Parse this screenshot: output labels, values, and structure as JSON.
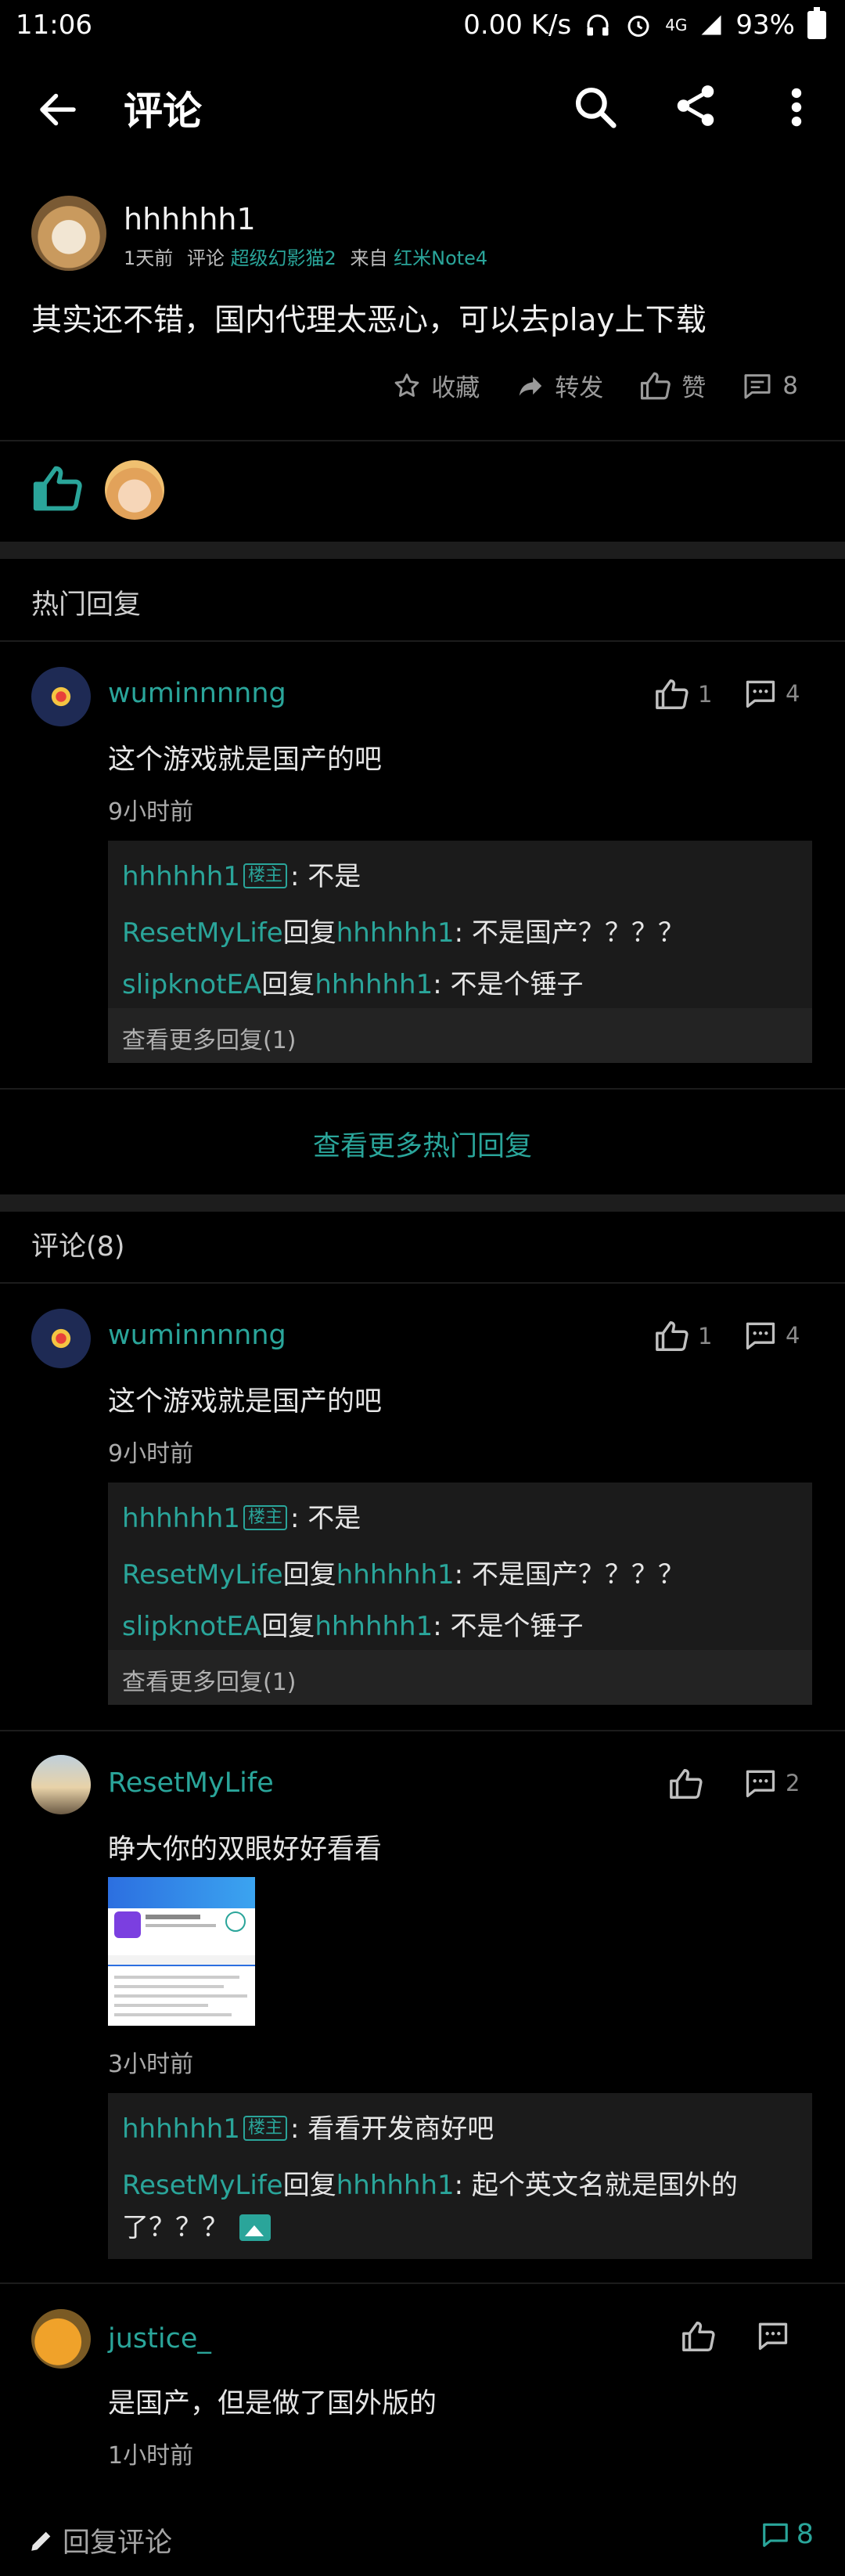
{
  "status_bar": {
    "time": "11:06",
    "speed": "0.00 K/s",
    "network": "4G",
    "battery": "93%"
  },
  "app_bar": {
    "title": "评论"
  },
  "post": {
    "username": "hhhhhh1",
    "time": "1天前",
    "comment_label": "评论",
    "game": "超级幻影猫2",
    "from_label": "来自",
    "device": "红米Note4",
    "text": "其实还不错，国内代理太恶心，可以去play上下载",
    "actions": {
      "favorite": "收藏",
      "repost": "转发",
      "like": "赞",
      "comments": "8"
    }
  },
  "hot_section": {
    "title": "热门回复",
    "more_label": "查看更多热门回复"
  },
  "all_section": {
    "title": "评论(8)"
  },
  "comments": [
    {
      "username": "wuminnnnng",
      "likes": "1",
      "replies": "4",
      "text": "这个游戏就是国产的吧",
      "time": "9小时前",
      "reply_lines": [
        {
          "user": "hhhhhh1",
          "tag": "楼主",
          "text": ": 不是"
        },
        {
          "user": "ResetMyLife",
          "mid": "回复",
          "target": "hhhhhh1",
          "text": ": 不是国产？？？？"
        },
        {
          "user": "slipknotEA",
          "mid": "回复",
          "target": "hhhhhh1",
          "text": ": 不是个锤子"
        }
      ],
      "more_replies": "查看更多回复(1)"
    },
    {
      "username": "wuminnnnng",
      "likes": "1",
      "replies": "4",
      "text": "这个游戏就是国产的吧",
      "time": "9小时前",
      "reply_lines": [
        {
          "user": "hhhhhh1",
          "tag": "楼主",
          "text": ": 不是"
        },
        {
          "user": "ResetMyLife",
          "mid": "回复",
          "target": "hhhhhh1",
          "text": ": 不是国产？？？？"
        },
        {
          "user": "slipknotEA",
          "mid": "回复",
          "target": "hhhhhh1",
          "text": ": 不是个锤子"
        }
      ],
      "more_replies": "查看更多回复(1)"
    },
    {
      "username": "ResetMyLife",
      "replies": "2",
      "text": "睁大你的双眼好好看看",
      "time": "3小时前",
      "reply_lines": [
        {
          "user": "hhhhhh1",
          "tag": "楼主",
          "text": ": 看看开发商好吧"
        },
        {
          "user": "ResetMyLife",
          "mid": "回复",
          "target": "hhhhhh1",
          "text": ": 起个英文名就是国外的",
          "text2": "了？？？"
        }
      ]
    },
    {
      "username": "justice_",
      "text": "是国产，但是做了国外版的",
      "time": "1小时前"
    }
  ],
  "bottom_bar": {
    "write_label": "回复评论",
    "comment_count": "8"
  },
  "colors": {
    "accent": "#2aa59a",
    "background": "#000000",
    "reply_bg": "#1b1b1b"
  }
}
